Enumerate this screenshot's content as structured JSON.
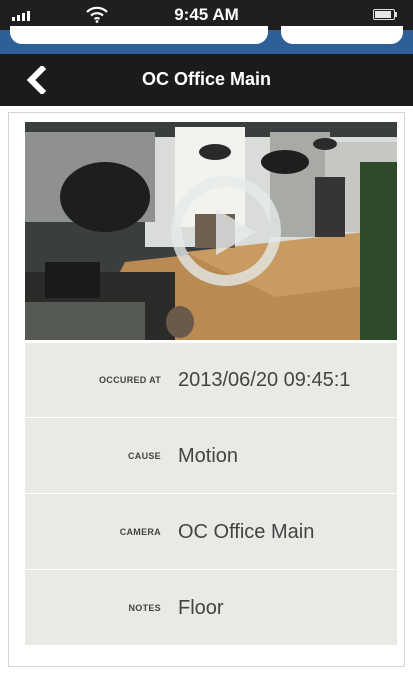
{
  "status_bar": {
    "time": "9:45 AM",
    "signal_icon": "signal-bars-icon",
    "wifi_icon": "wifi-icon",
    "battery_icon": "battery-icon"
  },
  "nav": {
    "title": "OC Office Main",
    "back_icon": "chevron-left-icon"
  },
  "video": {
    "play_icon": "play-icon"
  },
  "details": [
    {
      "label": "OCCURED AT",
      "value": "2013/06/20 09:45:1"
    },
    {
      "label": "CAUSE",
      "value": "Motion"
    },
    {
      "label": "CAMERA",
      "value": "OC Office Main"
    },
    {
      "label": "NOTES",
      "value": "Floor"
    }
  ],
  "colors": {
    "nav_background": "#1b1b1b",
    "search_strip": "#2f5f97",
    "details_background": "#ebe9e6"
  }
}
